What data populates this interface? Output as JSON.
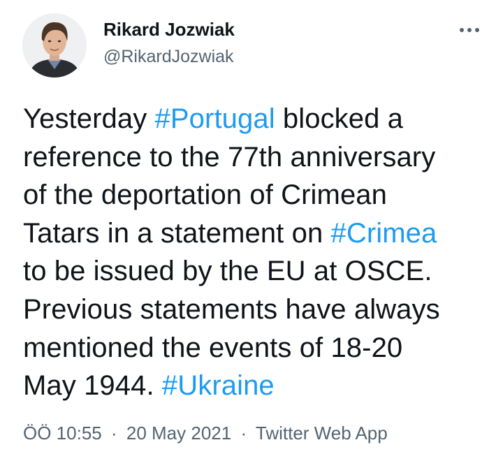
{
  "author": {
    "display_name": "Rikard Jozwiak",
    "handle": "@RikardJozwiak"
  },
  "more_icon": "more-horizontal-icon",
  "tweet": {
    "lines": [
      [
        {
          "t": "Yesterday "
        },
        {
          "t": "#Portugal",
          "tag": true
        },
        {
          "t": " blocked a"
        }
      ],
      [
        {
          "t": "reference to the 77th anniversary"
        }
      ],
      [
        {
          "t": "of the deportation of Crimean"
        }
      ],
      [
        {
          "t": "Tatars in a statement on "
        },
        {
          "t": "#Crimea",
          "tag": true
        }
      ],
      [
        {
          "t": "to be issued by the EU at OSCE."
        }
      ],
      [
        {
          "t": "Previous statements have always"
        }
      ],
      [
        {
          "t": "mentioned the events of 18-20"
        }
      ],
      [
        {
          "t": "May 1944. "
        },
        {
          "t": "#Ukraine",
          "tag": true
        }
      ]
    ]
  },
  "meta": {
    "time": "ÖÖ 10:55",
    "separator": "·",
    "date": "20 May 2021",
    "source": "Twitter Web App"
  },
  "colors": {
    "hashtag": "#1d9bf0",
    "secondary_text": "#536471",
    "primary_text": "#0f1419"
  }
}
